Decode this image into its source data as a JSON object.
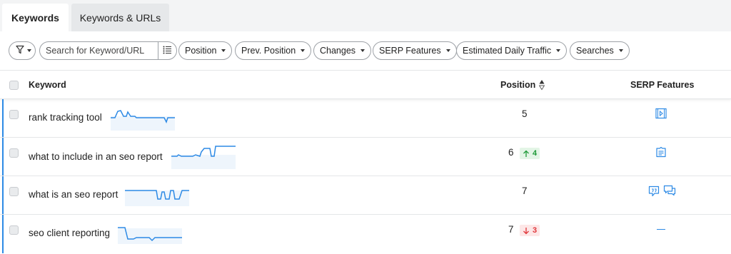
{
  "tabs": [
    {
      "label": "Keywords"
    },
    {
      "label": "Keywords & URLs"
    }
  ],
  "filters": {
    "search_placeholder": "Search for Keyword/URL",
    "dropdowns": [
      {
        "label": "Position"
      },
      {
        "label": "Prev. Position"
      },
      {
        "label": "Changes"
      },
      {
        "label": "SERP Features"
      },
      {
        "label": "Estimated Daily Traffic"
      },
      {
        "label": "Searches"
      }
    ]
  },
  "table": {
    "headers": {
      "keyword": "Keyword",
      "position": "Position",
      "serp": "SERP Features"
    },
    "rows": [
      {
        "keyword": "rank tracking tool",
        "position": "5",
        "change": "",
        "serp_icons": [
          "video-icon"
        ]
      },
      {
        "keyword": "what to include in an seo report",
        "position": "6",
        "change": "4",
        "change_dir": "up",
        "serp_icons": [
          "featured-snippet-icon"
        ]
      },
      {
        "keyword": "what is an seo report",
        "position": "7",
        "change": "",
        "serp_icons": [
          "quote-icon",
          "reviews-icon"
        ]
      },
      {
        "keyword": "seo client reporting",
        "position": "7",
        "change": "3",
        "change_dir": "down",
        "serp_icons": [
          "none-dash"
        ]
      }
    ]
  },
  "colors": {
    "accent": "#2d8ae5",
    "up": "#1e9a38",
    "down": "#e0353a",
    "border": "#9da1a6"
  }
}
